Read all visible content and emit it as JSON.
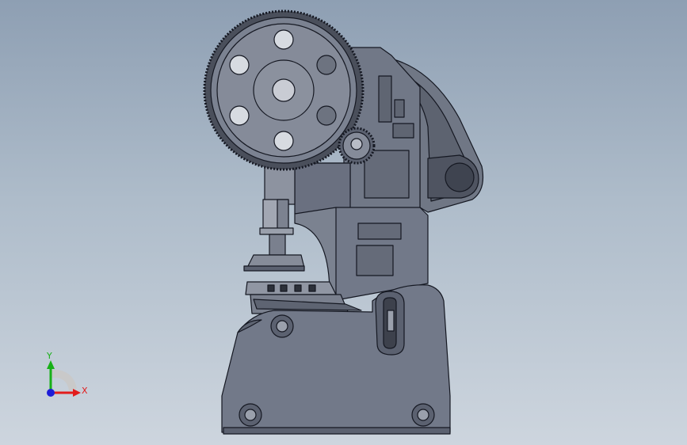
{
  "viewport": {
    "colors": {
      "background_top": "#8e9fb3",
      "background_bottom": "#cdd5de",
      "model_fill": "#6f7684",
      "model_edge": "#151822",
      "highlight": "#c9ccd4"
    }
  },
  "triad": {
    "x_label": "X",
    "y_label": "Y",
    "x_color": "#e21c1c",
    "y_color": "#17b017",
    "z_color": "#1d1dd8"
  }
}
